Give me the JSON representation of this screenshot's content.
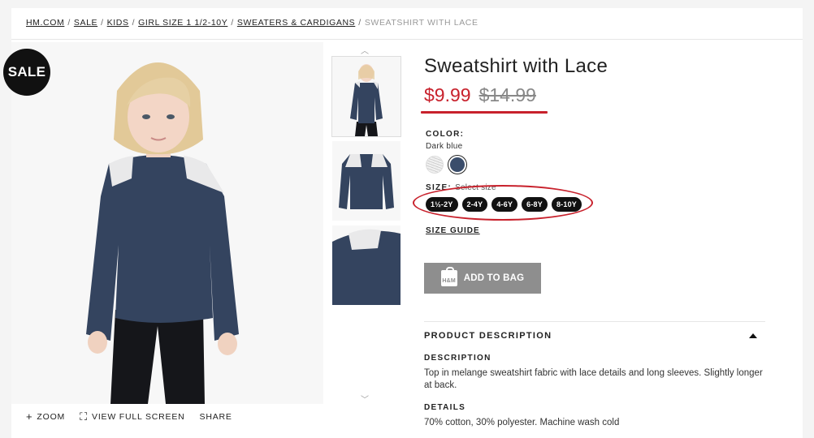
{
  "breadcrumb": {
    "items": [
      "HM.COM",
      "SALE",
      "KIDS",
      "GIRL SIZE 1 1/2-10Y",
      "SWEATERS & CARDIGANS"
    ],
    "current": "SWEATSHIRT WITH LACE",
    "separator": "/"
  },
  "badge": "SALE",
  "image_controls": {
    "zoom": "ZOOM",
    "fullscreen": "VIEW FULL SCREEN",
    "share": "SHARE"
  },
  "product": {
    "title": "Sweatshirt with Lace",
    "price_sale": "$9.99",
    "price_original": "$14.99",
    "color_label": "COLOR:",
    "color_name": "Dark blue",
    "size_label": "SIZE:",
    "size_hint": "Select size",
    "sizes": [
      "1½-2Y",
      "2-4Y",
      "4-6Y",
      "6-8Y",
      "8-10Y"
    ],
    "size_guide": "SIZE GUIDE",
    "add_to_bag": "ADD TO BAG",
    "bag_logo": "H&M"
  },
  "description": {
    "header": "PRODUCT DESCRIPTION",
    "desc_title": "DESCRIPTION",
    "desc_text": "Top in melange sweatshirt fabric with lace details and long sleeves. Slightly longer at back.",
    "details_title": "DETAILS",
    "details_text": "70% cotton, 30% polyester. Machine wash cold"
  },
  "colors": {
    "sale_red": "#c8212c",
    "navy": "#3a4d6b",
    "button_gray": "#8e8e8e"
  }
}
